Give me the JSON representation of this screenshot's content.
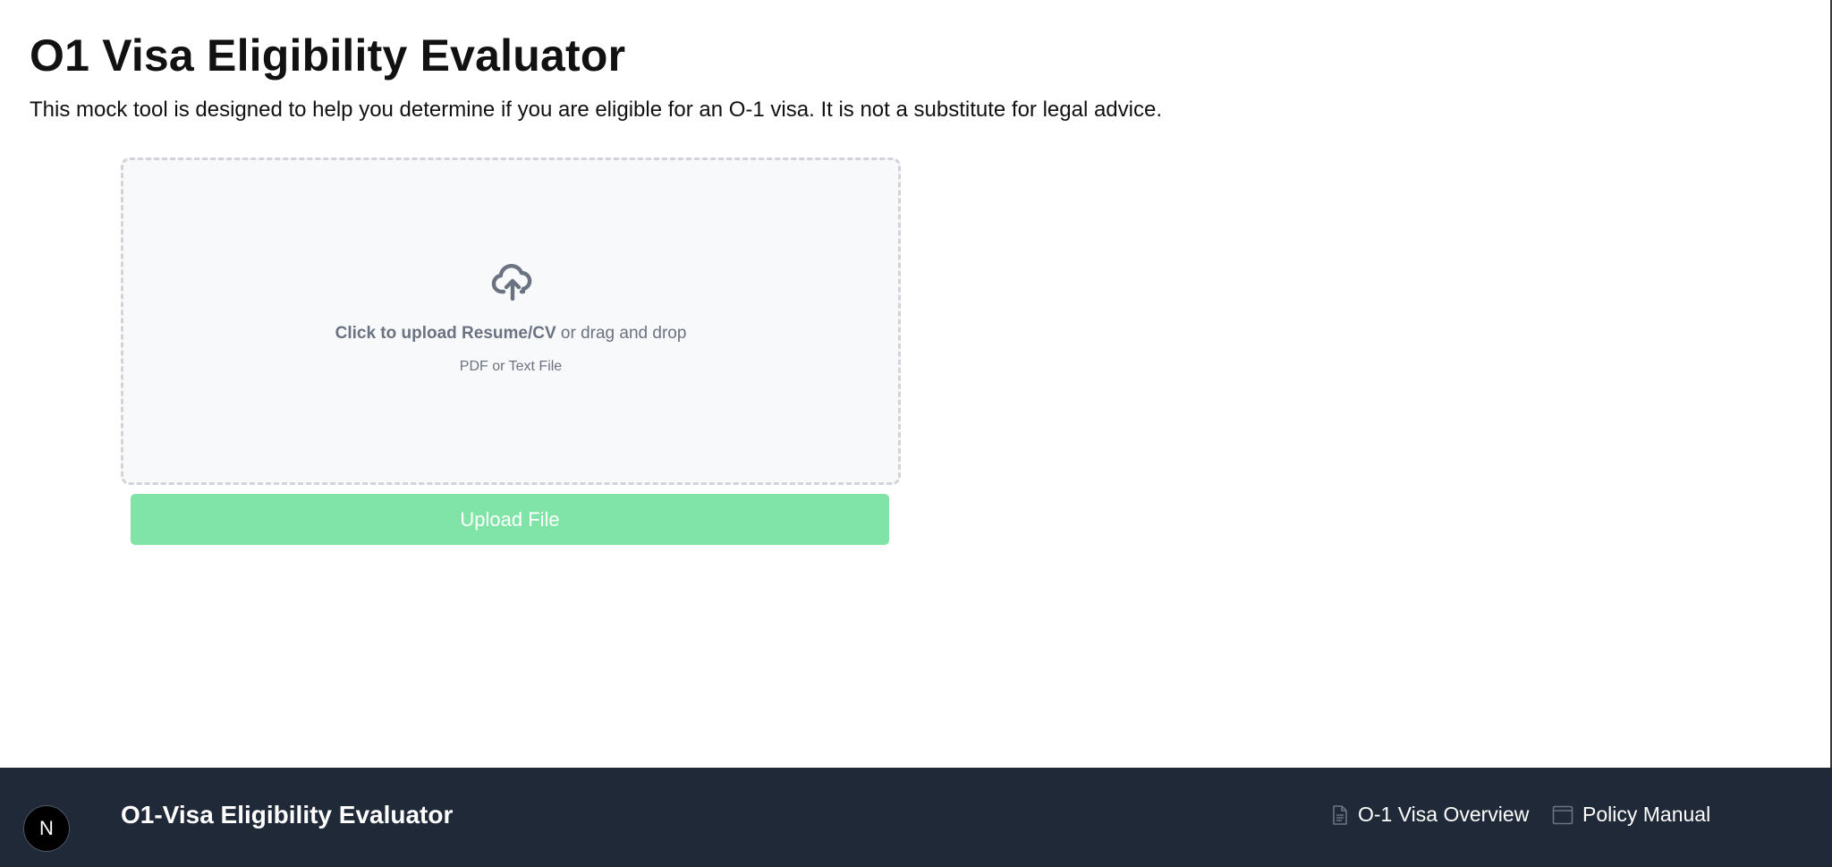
{
  "header": {
    "title": "O1 Visa Eligibility Evaluator",
    "description": "This mock tool is designed to help you determine if you are eligible for an O-1 visa. It is not a substitute for legal advice."
  },
  "upload": {
    "icon": "cloud-upload-icon",
    "prompt_bold": "Click to upload Resume/CV",
    "prompt_rest": " or drag and drop",
    "file_types": "PDF or Text File",
    "button_label": "Upload File",
    "button_color": "#80e4a6"
  },
  "footer": {
    "badge": "N",
    "title": "O1-Visa Eligibility Evaluator",
    "links": [
      {
        "label": "O-1 Visa Overview",
        "icon": "document-icon"
      },
      {
        "label": "Policy Manual",
        "icon": "window-icon"
      }
    ],
    "background": "#1f2937"
  }
}
